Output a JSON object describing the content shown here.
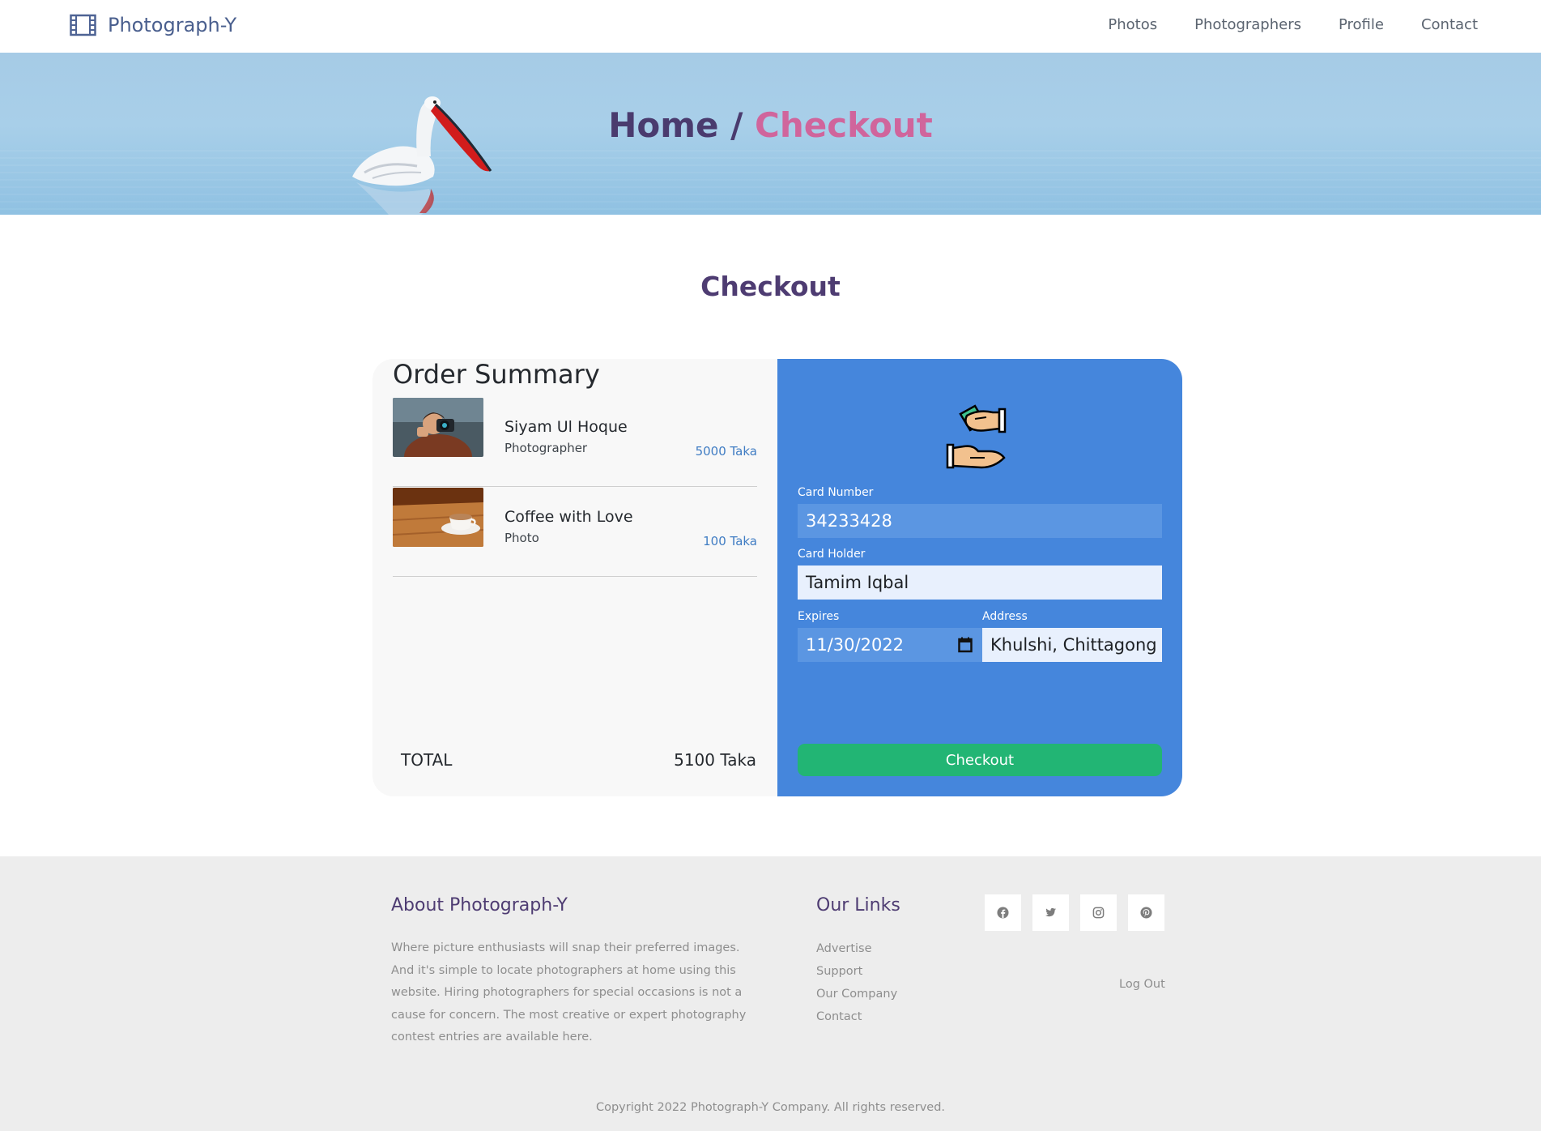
{
  "nav": {
    "brand": "Photograph-Y",
    "brand_icon": "film-icon",
    "links": [
      "Photos",
      "Photographers",
      "Profile",
      "Contact"
    ]
  },
  "hero": {
    "home": "Home",
    "separator": " / ",
    "current": "Checkout"
  },
  "page_title": "Checkout",
  "summary": {
    "title": "Order Summary",
    "items": [
      {
        "name": "Siyam Ul Hoque",
        "role": "Photographer",
        "price": "5000 Taka",
        "thumb_icon": "photographer-photo"
      },
      {
        "name": "Coffee with Love",
        "role": "Photo",
        "price": "100 Taka",
        "thumb_icon": "coffee-photo"
      }
    ],
    "total_label": "TOTAL",
    "total_value": "5100 Taka"
  },
  "payment": {
    "icon": "money-exchange-icon",
    "card_number_label": "Card Number",
    "card_number": "34233428",
    "card_holder_label": "Card Holder",
    "card_holder": "Tamim Iqbal",
    "expires_label": "Expires",
    "expires": "11/30/2022",
    "address_label": "Address",
    "address": "Khulshi, Chittagong",
    "button": "Checkout"
  },
  "footer": {
    "about_title": "About Photograph-Y",
    "about_text": "Where picture enthusiasts will snap their preferred images. And it's simple to locate photographers at home using this website. Hiring photographers for special occasions is not a cause for concern. The most creative or expert photography contest entries are available here.",
    "links_title": "Our Links",
    "links": [
      "Advertise",
      "Support",
      "Our Company",
      "Contact"
    ],
    "socials": [
      "facebook-icon",
      "twitter-icon",
      "instagram-icon",
      "pinterest-icon"
    ],
    "logout": "Log Out",
    "copyright": "Copyright 2022 Photograph-Y Company. All rights reserved."
  },
  "colors": {
    "accent": "#4e3c72",
    "highlight": "#d0659c",
    "payment_panel": "#4586dc",
    "button": "#22b574"
  }
}
